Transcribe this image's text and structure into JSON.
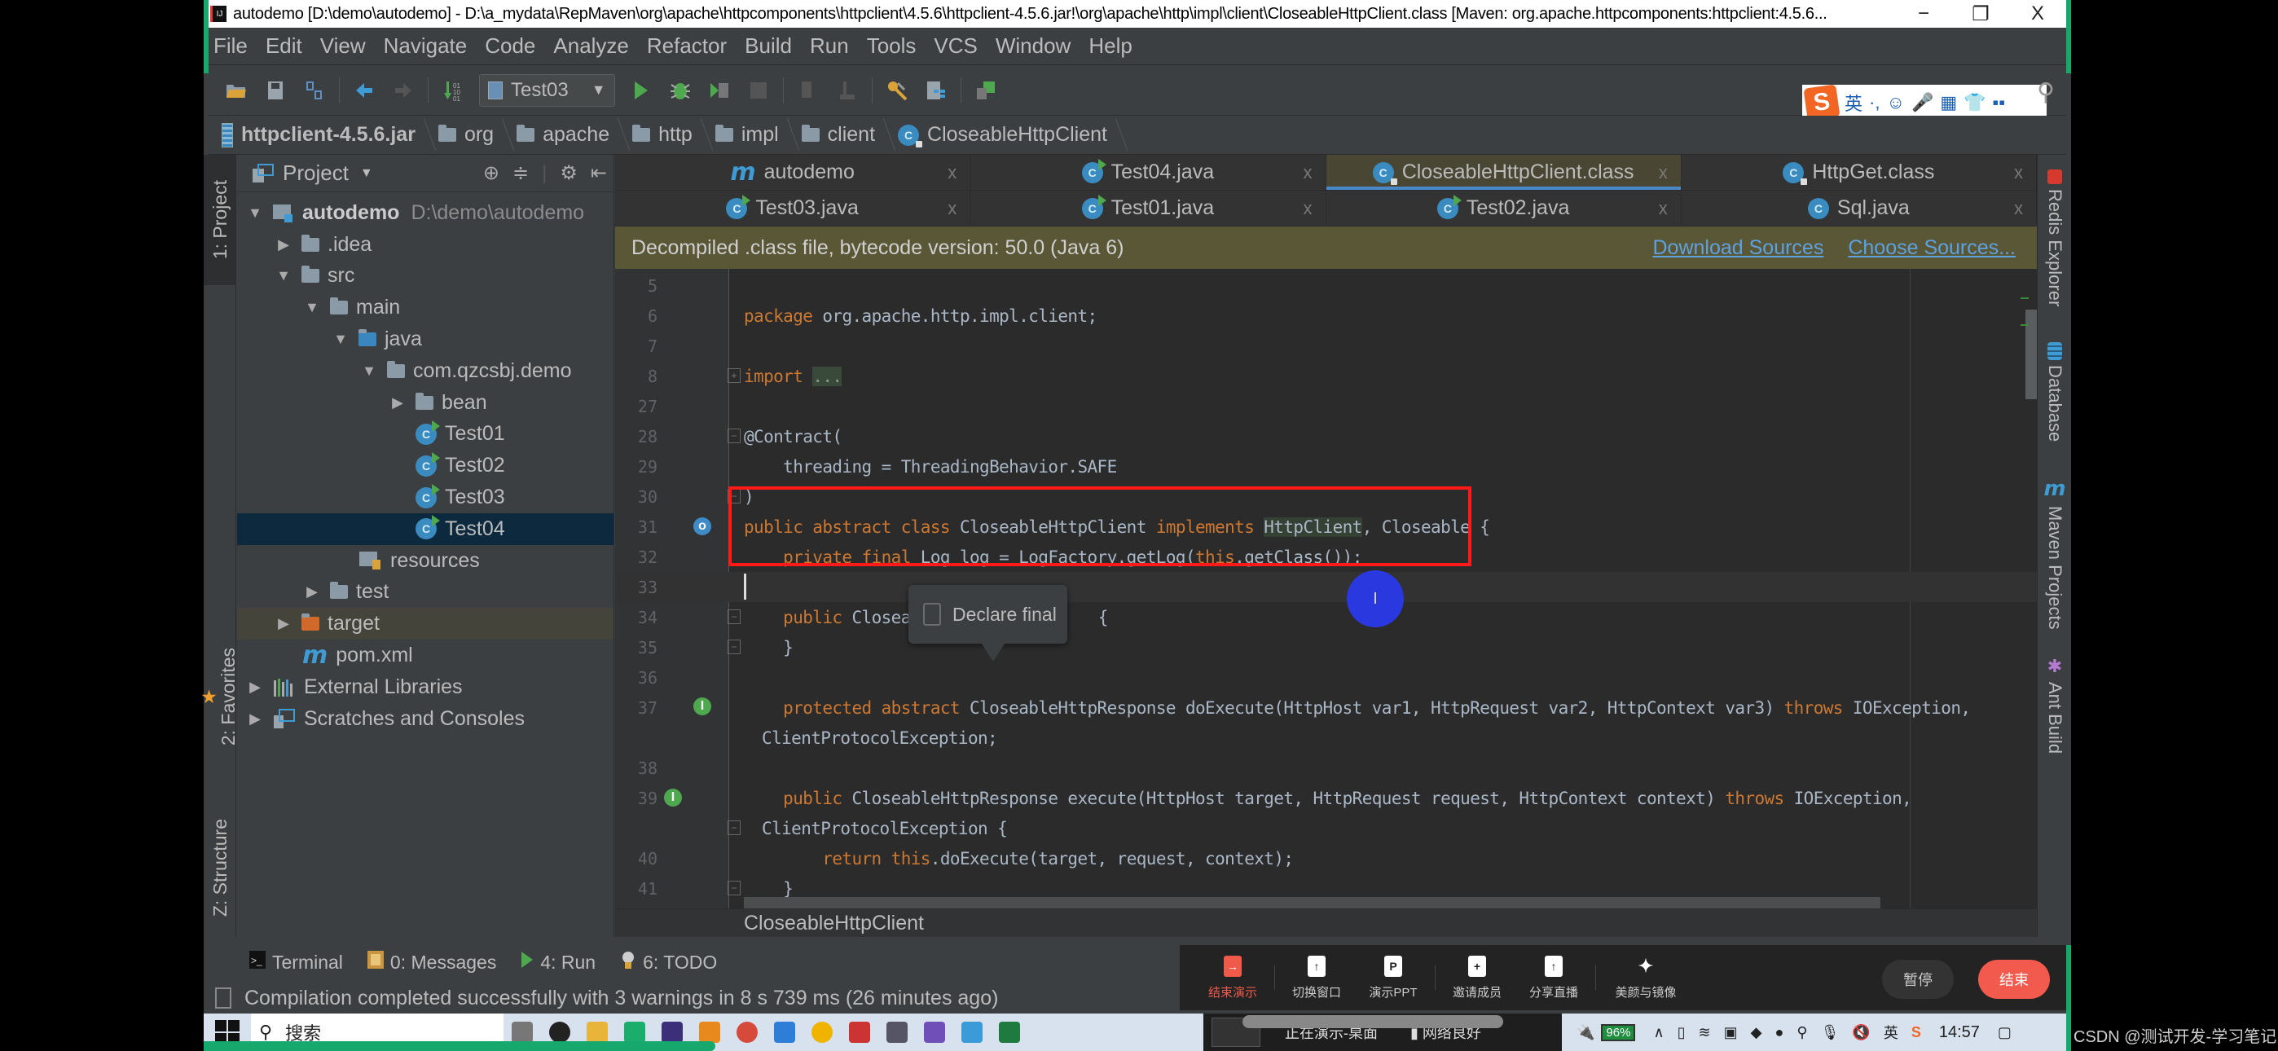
{
  "window": {
    "title": "autodemo [D:\\demo\\autodemo] - D:\\a_mydata\\RepMaven\\org\\apache\\httpcomponents\\httpclient\\4.5.6\\httpclient-4.5.6.jar!\\org\\apache\\http\\impl\\client\\CloseableHttpClient.class [Maven: org.apache.httpcomponents:httpclient:4.5.6...",
    "minimize": "−",
    "restore": "❐",
    "close": "X"
  },
  "menu": [
    "File",
    "Edit",
    "View",
    "Navigate",
    "Code",
    "Analyze",
    "Refactor",
    "Build",
    "Run",
    "Tools",
    "VCS",
    "Window",
    "Help"
  ],
  "toolbar": {
    "run_config": "Test03",
    "run_config_arrow": "▼"
  },
  "ime": {
    "logo": "S",
    "items": [
      "英",
      "·,",
      "☺",
      "🎤",
      "▦",
      "👕",
      "▪▪"
    ]
  },
  "breadcrumb": [
    {
      "label": "httpclient-4.5.6.jar",
      "icon": "jar-icon"
    },
    {
      "label": "org",
      "icon": "folder-icon"
    },
    {
      "label": "apache",
      "icon": "folder-icon"
    },
    {
      "label": "http",
      "icon": "folder-icon"
    },
    {
      "label": "impl",
      "icon": "folder-icon"
    },
    {
      "label": "client",
      "icon": "folder-icon"
    },
    {
      "label": "CloseableHttpClient",
      "icon": "class-icon"
    }
  ],
  "left_stripe": {
    "project": "1: Project",
    "favorites": "2: Favorites",
    "structure": "Z: Structure"
  },
  "project_panel": {
    "title": "Project",
    "dropdown": "▼",
    "tree": [
      {
        "label": "autodemo",
        "path": "D:\\demo\\autodemo",
        "depth": 0,
        "toggle": "▼",
        "icon": "module"
      },
      {
        "label": ".idea",
        "depth": 1,
        "toggle": "▶",
        "icon": "folder"
      },
      {
        "label": "src",
        "depth": 1,
        "toggle": "▼",
        "icon": "folder"
      },
      {
        "label": "main",
        "depth": 2,
        "toggle": "▼",
        "icon": "folder"
      },
      {
        "label": "java",
        "depth": 3,
        "toggle": "▼",
        "icon": "source-folder"
      },
      {
        "label": "com.qzcsbj.demo",
        "depth": 4,
        "toggle": "▼",
        "icon": "package"
      },
      {
        "label": "bean",
        "depth": 5,
        "toggle": "▶",
        "icon": "package"
      },
      {
        "label": "Test01",
        "depth": 5,
        "toggle": "",
        "icon": "class"
      },
      {
        "label": "Test02",
        "depth": 5,
        "toggle": "",
        "icon": "class"
      },
      {
        "label": "Test03",
        "depth": 5,
        "toggle": "",
        "icon": "class"
      },
      {
        "label": "Test04",
        "depth": 5,
        "toggle": "",
        "icon": "class"
      },
      {
        "label": "resources",
        "depth": 4,
        "toggle": "",
        "icon": "resources-folder"
      },
      {
        "label": "test",
        "depth": 2,
        "toggle": "▶",
        "icon": "folder"
      },
      {
        "label": "target",
        "depth": 1,
        "toggle": "▶",
        "icon": "excluded-folder"
      },
      {
        "label": "pom.xml",
        "depth": 1,
        "toggle": "",
        "icon": "maven"
      },
      {
        "label": "External Libraries",
        "depth": 0,
        "toggle": "▶",
        "icon": "libraries"
      },
      {
        "label": "Scratches and Consoles",
        "depth": 0,
        "toggle": "▶",
        "icon": "scratches"
      }
    ],
    "selected": "Test04"
  },
  "tabs_row1": [
    {
      "label": "autodemo",
      "icon": "maven",
      "close": "x"
    },
    {
      "label": "Test04.java",
      "icon": "class-modified",
      "close": "x"
    },
    {
      "label": "CloseableHttpClient.class",
      "icon": "class-locked",
      "close": "x",
      "active": true
    },
    {
      "label": "HttpGet.class",
      "icon": "class-locked",
      "close": "x"
    }
  ],
  "tabs_row2": [
    {
      "label": "Test03.java",
      "icon": "class-run",
      "close": "x"
    },
    {
      "label": "Test01.java",
      "icon": "class-run",
      "close": "x"
    },
    {
      "label": "Test02.java",
      "icon": "class-run",
      "close": "x"
    },
    {
      "label": "Sql.java",
      "icon": "class",
      "close": "x"
    }
  ],
  "banner": {
    "text": "Decompiled .class file, bytecode version: 50.0 (Java 6)",
    "download": "Download Sources",
    "choose": "Choose Sources..."
  },
  "code": {
    "line_numbers": [
      "5",
      "6",
      "7",
      "8",
      "27",
      "28",
      "29",
      "30",
      "31",
      "32",
      "33",
      "34",
      "35",
      "36",
      "37",
      "",
      "38",
      "39",
      "",
      "40",
      "41"
    ],
    "lines": {
      "l6_kw": "package",
      "l6_rest": " org.apache.http.impl.client;",
      "l8_kw": "import",
      "l8_fold": "...",
      "l28": "@Contract(",
      "l29": "    threading = ThreadingBehavior.SAFE",
      "l30": ")",
      "l31_kw": "public abstract class",
      "l31_name": " CloseableHttpClient ",
      "l31_impl": "implements",
      "l31_ref": "HttpClient",
      "l31_rest": ", Closeable {",
      "l32_kw": "    private final",
      "l32_mid": " Log log = LogFactory.getLog(",
      "l32_this": "this",
      "l32_rest": ".getClass());",
      "l34_kw": "    public",
      "l34_rest": " Closea",
      "l34_brace": "{",
      "l35": "    }",
      "l37_kw": "    protected abstract",
      "l37_rest": " CloseableHttpResponse doExecute(HttpHost var1, HttpRequest var2, HttpContext var3) ",
      "l37_throws": "throws",
      "l37_end": " IOException,",
      "l37b": " ClientProtocolException;",
      "l39_kw": "    public",
      "l39_rest": " CloseableHttpResponse execute(HttpHost target, HttpRequest request, HttpContext context) ",
      "l39_throws": "throws",
      "l39_end": " IOException,",
      "l39b": " ClientProtocolException {",
      "l40_kw": "        return this",
      "l40_rest": ".doExecute(target, request, context);",
      "l41": "    }"
    }
  },
  "tooltip": {
    "label": "Declare final",
    "checked": false
  },
  "cursor_glyph": "I",
  "editor_breadcrumb": "CloseableHttpClient",
  "right_stripe": [
    "Redis Explorer",
    "Database",
    "Maven Projects",
    "Ant Build"
  ],
  "bottom_tools": [
    {
      "label": "Terminal",
      "icon": "terminal-icon"
    },
    {
      "label": "0: Messages",
      "icon": "messages-icon"
    },
    {
      "label": "4: Run",
      "icon": "run-icon"
    },
    {
      "label": "6: TODO",
      "icon": "todo-icon"
    }
  ],
  "status": "Compilation completed successfully with 3 warnings in 8 s 739 ms (26 minutes ago)",
  "meeting": {
    "items": [
      {
        "label": "结束演示",
        "glyph": "→"
      },
      {
        "label": "切换窗口",
        "glyph": "↑"
      },
      {
        "label": "演示PPT",
        "glyph": "P"
      },
      {
        "label": "邀请成员",
        "glyph": "+"
      },
      {
        "label": "分享直播",
        "glyph": "↑"
      },
      {
        "label": "美颜与镜像",
        "glyph": "✦"
      }
    ],
    "pause": "暂停",
    "end": "结束"
  },
  "taskbar": {
    "search": "搜索",
    "presenting": "正在演示-桌面",
    "network": "网络良好",
    "battery": "96%",
    "ime": "英",
    "time": "14:57"
  },
  "watermark": "CSDN @测试开发-学习笔记"
}
